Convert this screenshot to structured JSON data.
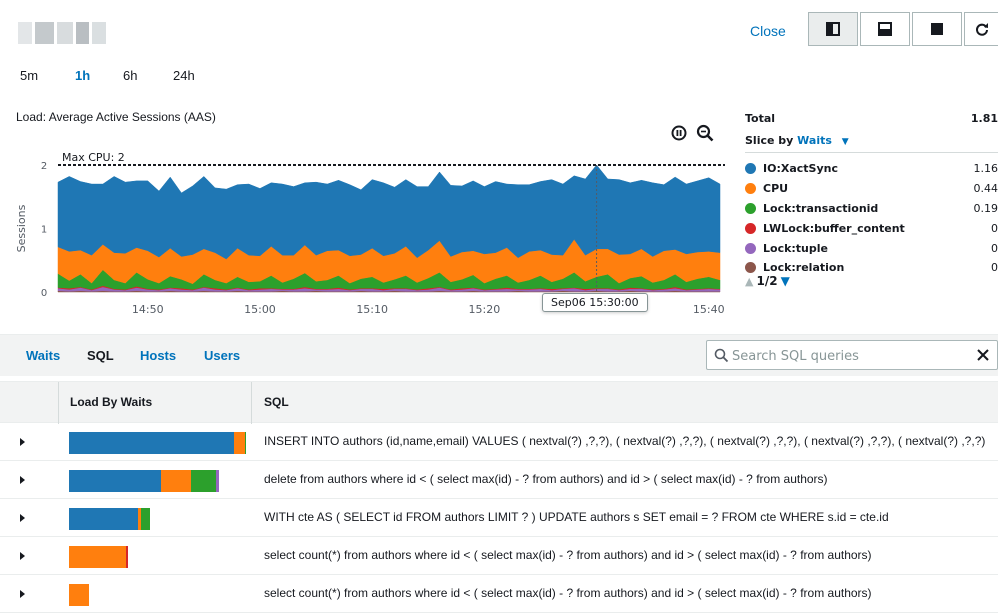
{
  "header": {
    "close_label": "Close",
    "view_buttons": [
      "split-vertical-icon",
      "split-horizontal-icon",
      "full-view-icon",
      "refresh-icon"
    ]
  },
  "time_ranges": [
    {
      "label": "5m",
      "active": false
    },
    {
      "label": "1h",
      "active": true
    },
    {
      "label": "6h",
      "active": false
    },
    {
      "label": "24h",
      "active": false
    }
  ],
  "chart": {
    "title": "Load: Average Active Sessions (AAS)",
    "tools": [
      "pause-icon",
      "zoom-icon"
    ],
    "tooltip": "Sep06 15:30:00"
  },
  "chart_data": {
    "type": "area",
    "stacked": true,
    "ylabel": "Sessions",
    "ylim": [
      0,
      2
    ],
    "yticks": [
      "0",
      "1",
      "2"
    ],
    "threshold": {
      "label": "Max CPU: 2",
      "value": 2
    },
    "x_range": [
      "14:42",
      "15:41"
    ],
    "xticks": [
      "14:50",
      "15:00",
      "15:10",
      "15:20",
      "15:30",
      "15:40"
    ],
    "crosshair_x": "15:30",
    "x": [
      "14:42",
      "14:43",
      "14:44",
      "14:45",
      "14:46",
      "14:47",
      "14:48",
      "14:49",
      "14:50",
      "14:51",
      "14:52",
      "14:53",
      "14:54",
      "14:55",
      "14:56",
      "14:57",
      "14:58",
      "14:59",
      "15:00",
      "15:01",
      "15:02",
      "15:03",
      "15:04",
      "15:05",
      "15:06",
      "15:07",
      "15:08",
      "15:09",
      "15:10",
      "15:11",
      "15:12",
      "15:13",
      "15:14",
      "15:15",
      "15:16",
      "15:17",
      "15:18",
      "15:19",
      "15:20",
      "15:21",
      "15:22",
      "15:23",
      "15:24",
      "15:25",
      "15:26",
      "15:27",
      "15:28",
      "15:29",
      "15:30",
      "15:31",
      "15:32",
      "15:33",
      "15:34",
      "15:35",
      "15:36",
      "15:37",
      "15:38",
      "15:39",
      "15:40",
      "15:41"
    ],
    "series": [
      {
        "name": "Lock:relation",
        "color": "#8c564b",
        "values": [
          0.02,
          0.01,
          0.02,
          0.01,
          0.02,
          0.01,
          0.01,
          0.02,
          0.01,
          0.01,
          0.02,
          0.01,
          0.01,
          0.02,
          0.01,
          0.01,
          0.02,
          0.01,
          0.01,
          0.01,
          0.02,
          0.01,
          0.01,
          0.02,
          0.01,
          0.01,
          0.01,
          0.02,
          0.01,
          0.01,
          0.02,
          0.01,
          0.01,
          0.01,
          0.02,
          0.01,
          0.01,
          0.02,
          0.01,
          0.01,
          0.01,
          0.02,
          0.01,
          0.01,
          0.01,
          0.02,
          0.01,
          0.01,
          0.02,
          0.01,
          0.01,
          0.02,
          0.01,
          0.01,
          0.01,
          0.02,
          0.01,
          0.01,
          0.01,
          0.01
        ]
      },
      {
        "name": "Lock:tuple",
        "color": "#9467bd",
        "values": [
          0.04,
          0.03,
          0.05,
          0.02,
          0.06,
          0.03,
          0.02,
          0.05,
          0.03,
          0.02,
          0.04,
          0.03,
          0.02,
          0.05,
          0.03,
          0.02,
          0.04,
          0.02,
          0.03,
          0.04,
          0.02,
          0.03,
          0.05,
          0.02,
          0.03,
          0.04,
          0.02,
          0.03,
          0.04,
          0.02,
          0.03,
          0.04,
          0.02,
          0.03,
          0.05,
          0.02,
          0.03,
          0.04,
          0.02,
          0.03,
          0.04,
          0.02,
          0.03,
          0.04,
          0.02,
          0.03,
          0.05,
          0.02,
          0.03,
          0.04,
          0.02,
          0.03,
          0.04,
          0.02,
          0.03,
          0.04,
          0.02,
          0.03,
          0.04,
          0.03
        ]
      },
      {
        "name": "LWLock:buffer_content",
        "color": "#d62728",
        "values": [
          0.01,
          0.02,
          0.01,
          0.01,
          0.02,
          0.01,
          0.01,
          0.02,
          0.01,
          0.01,
          0.01,
          0.02,
          0.01,
          0.01,
          0.02,
          0.01,
          0.01,
          0.01,
          0.02,
          0.01,
          0.01,
          0.01,
          0.02,
          0.01,
          0.01,
          0.02,
          0.01,
          0.01,
          0.01,
          0.02,
          0.01,
          0.01,
          0.01,
          0.02,
          0.01,
          0.01,
          0.02,
          0.01,
          0.01,
          0.01,
          0.02,
          0.01,
          0.01,
          0.01,
          0.02,
          0.01,
          0.01,
          0.02,
          0.01,
          0.01,
          0.01,
          0.02,
          0.01,
          0.01,
          0.01,
          0.02,
          0.01,
          0.01,
          0.01,
          0.01
        ]
      },
      {
        "name": "Lock:transactionid",
        "color": "#2ca02c",
        "values": [
          0.22,
          0.12,
          0.2,
          0.1,
          0.25,
          0.14,
          0.1,
          0.22,
          0.15,
          0.1,
          0.18,
          0.14,
          0.09,
          0.2,
          0.13,
          0.1,
          0.17,
          0.12,
          0.11,
          0.2,
          0.1,
          0.16,
          0.22,
          0.12,
          0.14,
          0.19,
          0.1,
          0.15,
          0.18,
          0.1,
          0.14,
          0.2,
          0.11,
          0.16,
          0.23,
          0.12,
          0.14,
          0.2,
          0.1,
          0.16,
          0.19,
          0.1,
          0.14,
          0.2,
          0.11,
          0.15,
          0.24,
          0.12,
          0.18,
          0.22,
          0.1,
          0.15,
          0.19,
          0.11,
          0.14,
          0.2,
          0.12,
          0.16,
          0.18,
          0.14
        ]
      },
      {
        "name": "CPU",
        "color": "#ff7f0e",
        "values": [
          0.42,
          0.46,
          0.38,
          0.44,
          0.4,
          0.43,
          0.47,
          0.39,
          0.45,
          0.41,
          0.44,
          0.36,
          0.46,
          0.4,
          0.43,
          0.38,
          0.45,
          0.42,
          0.4,
          0.46,
          0.43,
          0.37,
          0.44,
          0.41,
          0.46,
          0.4,
          0.43,
          0.38,
          0.45,
          0.42,
          0.41,
          0.46,
          0.39,
          0.44,
          0.5,
          0.4,
          0.43,
          0.38,
          0.46,
          0.41,
          0.44,
          0.39,
          0.45,
          0.4,
          0.43,
          0.37,
          0.52,
          0.41,
          0.44,
          0.4,
          0.45,
          0.38,
          0.43,
          0.41,
          0.46,
          0.39,
          0.44,
          0.42,
          0.4,
          0.43
        ]
      },
      {
        "name": "IO:XactSync",
        "color": "#1f77b4",
        "values": [
          1.02,
          1.18,
          1.08,
          1.12,
          0.95,
          1.2,
          1.12,
          1.05,
          1.1,
          1.04,
          1.12,
          1.0,
          1.08,
          1.14,
          1.02,
          1.1,
          1.0,
          1.12,
          1.06,
          1.0,
          1.12,
          1.08,
          0.98,
          1.15,
          1.05,
          1.1,
          1.12,
          1.02,
          1.08,
          1.15,
          1.04,
          1.05,
          1.12,
          1.0,
          1.08,
          1.12,
          1.04,
          1.1,
          1.06,
          1.12,
          1.0,
          1.15,
          1.05,
          1.08,
          1.18,
          1.12,
          1.0,
          1.2,
          1.32,
          1.1,
          1.18,
          1.12,
          1.08,
          1.16,
          1.04,
          1.14,
          1.1,
          1.12,
          1.16,
          1.08
        ]
      }
    ]
  },
  "legend": {
    "total_label": "Total",
    "total_value": "1.81",
    "slice_prefix": "Slice by",
    "slice_value": "Waits",
    "items": [
      {
        "label": "IO:XactSync",
        "value": "1.16",
        "color": "#1f77b4"
      },
      {
        "label": "CPU",
        "value": "0.44",
        "color": "#ff7f0e"
      },
      {
        "label": "Lock:transactionid",
        "value": "0.19",
        "color": "#2ca02c"
      },
      {
        "label": "LWLock:buffer_content",
        "value": "0",
        "color": "#d62728"
      },
      {
        "label": "Lock:tuple",
        "value": "0",
        "color": "#9467bd"
      },
      {
        "label": "Lock:relation",
        "value": "0",
        "color": "#8c564b"
      }
    ],
    "page_label": "1/2"
  },
  "tabs": [
    {
      "label": "Waits",
      "active": false
    },
    {
      "label": "SQL",
      "active": true
    },
    {
      "label": "Hosts",
      "active": false
    },
    {
      "label": "Users",
      "active": false
    }
  ],
  "search": {
    "placeholder": "Search SQL queries",
    "value": ""
  },
  "table": {
    "columns": [
      "Load By Waits",
      "SQL"
    ],
    "rows": [
      {
        "sql": "INSERT INTO authors (id,name,email) VALUES ( nextval(?) ,?,?), ( nextval(?) ,?,?), ( nextval(?) ,?,?), ( nextval(?) ,?,?), ( nextval(?) ,?,?)",
        "load": [
          {
            "wait": "IO:XactSync",
            "value": 1.1
          },
          {
            "wait": "CPU",
            "value": 0.07
          },
          {
            "wait": "Lock:transactionid",
            "value": 0.01
          }
        ]
      },
      {
        "sql": "delete from authors where id < ( select max(id) - ? from authors) and id > ( select max(id) - ? from authors)",
        "load": [
          {
            "wait": "IO:XactSync",
            "value": 0.61
          },
          {
            "wait": "CPU",
            "value": 0.2
          },
          {
            "wait": "Lock:transactionid",
            "value": 0.17
          },
          {
            "wait": "Lock:tuple",
            "value": 0.02
          }
        ]
      },
      {
        "sql": "WITH cte AS ( SELECT id FROM authors LIMIT ? ) UPDATE authors s SET email = ? FROM cte WHERE s.id = cte.id",
        "load": [
          {
            "wait": "IO:XactSync",
            "value": 0.46
          },
          {
            "wait": "CPU",
            "value": 0.02
          },
          {
            "wait": "Lock:transactionid",
            "value": 0.06
          }
        ]
      },
      {
        "sql": "select count(*) from authors where id < ( select max(id) - ? from authors) and id > ( select max(id) - ? from authors)",
        "load": [
          {
            "wait": "CPU",
            "value": 0.38
          },
          {
            "wait": "LWLock:buffer_content",
            "value": 0.01
          }
        ]
      },
      {
        "sql": "select count(*) from authors where id < ( select max(id) - ? from authors) and id > ( select max(id) - ? from authors)",
        "load": [
          {
            "wait": "CPU",
            "value": 0.13
          }
        ]
      }
    ]
  }
}
